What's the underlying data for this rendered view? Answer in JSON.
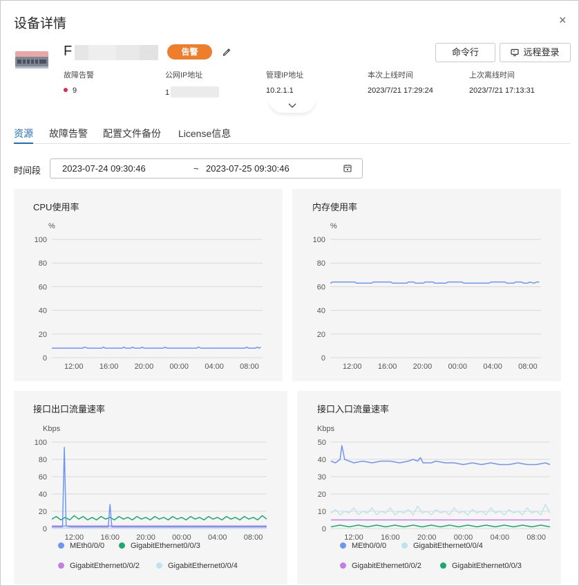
{
  "dialog": {
    "title": "设备详情",
    "close_glyph": "×"
  },
  "device": {
    "name_visible": "F",
    "status_badge": "告警",
    "buttons": {
      "command": "命令行",
      "remote_login": "远程登录"
    },
    "info": [
      {
        "label": "故障告警",
        "value": "9"
      },
      {
        "label": "公网IP地址",
        "value": "1"
      },
      {
        "label": "管理IP地址",
        "value": "10.2.1.1"
      },
      {
        "label": "本次上线时间",
        "value": "2023/7/21 17:29:24"
      },
      {
        "label": "上次离线时间",
        "value": "2023/7/21 17:13:31"
      }
    ]
  },
  "tabs": [
    {
      "label": "资源",
      "active": true
    },
    {
      "label": "故障告警",
      "active": false
    },
    {
      "label": "配置文件备份",
      "active": false
    },
    {
      "label": "License信息",
      "active": false
    }
  ],
  "period": {
    "label": "时间段",
    "start": "2023-07-24 09:30:46",
    "separator": "~",
    "end": "2023-07-25 09:30:46"
  },
  "colors": {
    "accent": "#1f6fba",
    "alarm": "#ee7d2c",
    "line_blue": "#6f95f2"
  },
  "chart_data": [
    {
      "type": "line",
      "title": "CPU使用率",
      "ylabel": "%",
      "ylim": [
        0,
        100
      ],
      "yticks": [
        0,
        20,
        40,
        60,
        80,
        100
      ],
      "xticks": [
        "12:00",
        "16:00",
        "20:00",
        "00:00",
        "04:00",
        "08:00"
      ],
      "xlim": [
        9.5,
        33.5
      ],
      "series": [
        {
          "color": "#6f95f2",
          "points": [
            [
              9.5,
              8
            ],
            [
              13.0,
              8
            ],
            [
              13.2,
              9
            ],
            [
              13.6,
              8
            ],
            [
              15.2,
              8
            ],
            [
              15.4,
              9
            ],
            [
              15.6,
              8
            ],
            [
              17.5,
              8
            ],
            [
              17.7,
              9
            ],
            [
              17.9,
              8
            ],
            [
              18.5,
              8
            ],
            [
              18.7,
              9
            ],
            [
              18.9,
              8
            ],
            [
              19.6,
              8
            ],
            [
              19.8,
              9
            ],
            [
              20.0,
              8
            ],
            [
              22.2,
              8
            ],
            [
              22.4,
              9
            ],
            [
              22.6,
              8
            ],
            [
              26.0,
              8
            ],
            [
              26.2,
              9
            ],
            [
              26.5,
              8
            ],
            [
              31.5,
              8
            ],
            [
              31.7,
              9
            ],
            [
              31.9,
              8
            ],
            [
              32.7,
              8
            ],
            [
              32.9,
              9
            ],
            [
              33.1,
              8
            ],
            [
              33.3,
              9
            ]
          ]
        }
      ]
    },
    {
      "type": "line",
      "title": "内存使用率",
      "ylabel": "%",
      "ylim": [
        0,
        100
      ],
      "yticks": [
        0,
        20,
        40,
        60,
        80,
        100
      ],
      "xticks": [
        "12:00",
        "16:00",
        "20:00",
        "00:00",
        "04:00",
        "08:00"
      ],
      "xlim": [
        9.5,
        33.5
      ],
      "series": [
        {
          "color": "#6f95f2",
          "points": [
            [
              9.5,
              63
            ],
            [
              9.8,
              64
            ],
            [
              12.3,
              64
            ],
            [
              12.5,
              63
            ],
            [
              14.2,
              63
            ],
            [
              14.4,
              64
            ],
            [
              16.4,
              64
            ],
            [
              16.6,
              63
            ],
            [
              18.2,
              63
            ],
            [
              18.4,
              64
            ],
            [
              19.0,
              64
            ],
            [
              19.2,
              63
            ],
            [
              20.1,
              63
            ],
            [
              20.3,
              64
            ],
            [
              21.2,
              64
            ],
            [
              21.4,
              63
            ],
            [
              22.7,
              63
            ],
            [
              22.9,
              64
            ],
            [
              24.5,
              64
            ],
            [
              24.7,
              63
            ],
            [
              27.6,
              63
            ],
            [
              27.8,
              64
            ],
            [
              29.4,
              64
            ],
            [
              29.6,
              63
            ],
            [
              30.4,
              63
            ],
            [
              30.6,
              64
            ],
            [
              31.3,
              64
            ],
            [
              31.5,
              63
            ],
            [
              32.0,
              63
            ],
            [
              32.2,
              64
            ],
            [
              32.7,
              63
            ],
            [
              33.0,
              64
            ],
            [
              33.3,
              64
            ]
          ]
        }
      ]
    },
    {
      "type": "line",
      "title": "接口出口流量速率",
      "ylabel": "Kbps",
      "ylim": [
        0,
        100
      ],
      "yticks": [
        0,
        20,
        40,
        60,
        80,
        100
      ],
      "xticks": [
        "12:00",
        "16:00",
        "20:00",
        "00:00",
        "04:00",
        "08:00"
      ],
      "xlim": [
        9.5,
        33.5
      ],
      "series": [
        {
          "name": "MEth0/0/0",
          "color": "#6f95f2",
          "points": [
            [
              9.5,
              2
            ],
            [
              10.7,
              2
            ],
            [
              10.9,
              94
            ],
            [
              11.1,
              3
            ],
            [
              11.6,
              2
            ],
            [
              15.8,
              2
            ],
            [
              16.0,
              28
            ],
            [
              16.2,
              2
            ],
            [
              33.5,
              2
            ]
          ]
        },
        {
          "name": "GigabitEthernet0/0/3",
          "color": "#1aaa6e",
          "points": [
            [
              9.5,
              11
            ],
            [
              10.0,
              14
            ],
            [
              10.5,
              10
            ],
            [
              11.0,
              13
            ],
            [
              11.5,
              10
            ],
            [
              12.0,
              15
            ],
            [
              12.5,
              11
            ],
            [
              13.0,
              14
            ],
            [
              13.5,
              10
            ],
            [
              14.0,
              13
            ],
            [
              14.5,
              10
            ],
            [
              15.0,
              14
            ],
            [
              15.5,
              11
            ],
            [
              16.0,
              13
            ],
            [
              16.5,
              10
            ],
            [
              17.0,
              14
            ],
            [
              17.5,
              11
            ],
            [
              18.0,
              13
            ],
            [
              18.5,
              10
            ],
            [
              19.0,
              14
            ],
            [
              19.5,
              11
            ],
            [
              20.0,
              13
            ],
            [
              20.5,
              10
            ],
            [
              21.0,
              14
            ],
            [
              21.5,
              11
            ],
            [
              22.0,
              13
            ],
            [
              22.5,
              10
            ],
            [
              23.0,
              14
            ],
            [
              23.5,
              11
            ],
            [
              24.0,
              13
            ],
            [
              24.5,
              10
            ],
            [
              25.0,
              14
            ],
            [
              25.5,
              11
            ],
            [
              26.0,
              13
            ],
            [
              26.5,
              10
            ],
            [
              27.0,
              14
            ],
            [
              27.5,
              11
            ],
            [
              28.0,
              13
            ],
            [
              28.5,
              10
            ],
            [
              29.0,
              14
            ],
            [
              29.5,
              11
            ],
            [
              30.0,
              13
            ],
            [
              30.5,
              10
            ],
            [
              31.0,
              14
            ],
            [
              31.5,
              11
            ],
            [
              32.0,
              13
            ],
            [
              32.5,
              10
            ],
            [
              33.0,
              15
            ],
            [
              33.5,
              11
            ]
          ]
        },
        {
          "name": "GigabitEthernet0/0/2",
          "color": "#c27de8",
          "points": [
            [
              9.5,
              3
            ],
            [
              33.5,
              3
            ]
          ]
        },
        {
          "name": "GigabitEthernet0/0/4",
          "color": "#bfe3ee",
          "points": [
            [
              9.5,
              1
            ],
            [
              33.5,
              1
            ]
          ]
        }
      ]
    },
    {
      "type": "line",
      "title": "接口入口流量速率",
      "ylabel": "Kbps",
      "ylim": [
        0,
        50
      ],
      "yticks": [
        0,
        10,
        20,
        30,
        40,
        50
      ],
      "xticks": [
        "12:00",
        "16:00",
        "20:00",
        "00:00",
        "04:00",
        "08:00"
      ],
      "xlim": [
        9.5,
        33.5
      ],
      "series": [
        {
          "name": "MEth0/0/0",
          "color": "#6f95f2",
          "points": [
            [
              9.5,
              39
            ],
            [
              10.0,
              38
            ],
            [
              10.5,
              40
            ],
            [
              10.7,
              48
            ],
            [
              11.0,
              40
            ],
            [
              11.5,
              39
            ],
            [
              12.0,
              38
            ],
            [
              13.0,
              39
            ],
            [
              14.0,
              38
            ],
            [
              15.0,
              39
            ],
            [
              16.0,
              39
            ],
            [
              17.0,
              38
            ],
            [
              18.0,
              39
            ],
            [
              18.5,
              40
            ],
            [
              19.0,
              39
            ],
            [
              19.3,
              41
            ],
            [
              19.6,
              38
            ],
            [
              20.5,
              38
            ],
            [
              21.0,
              39
            ],
            [
              22.0,
              38
            ],
            [
              23.0,
              38
            ],
            [
              24.0,
              37
            ],
            [
              25.0,
              38
            ],
            [
              26.0,
              37
            ],
            [
              27.0,
              38
            ],
            [
              28.0,
              37
            ],
            [
              29.0,
              37
            ],
            [
              30.0,
              38
            ],
            [
              31.0,
              37
            ],
            [
              32.0,
              37
            ],
            [
              33.0,
              38
            ],
            [
              33.5,
              37
            ]
          ]
        },
        {
          "name": "GigabitEthernet0/0/4",
          "color": "#bfe3ee",
          "points": [
            [
              9.5,
              9
            ],
            [
              10.0,
              11
            ],
            [
              10.5,
              8
            ],
            [
              11.0,
              10
            ],
            [
              11.5,
              9
            ],
            [
              12.0,
              12
            ],
            [
              12.5,
              8
            ],
            [
              13.0,
              10
            ],
            [
              13.5,
              9
            ],
            [
              14.0,
              12
            ],
            [
              14.5,
              8
            ],
            [
              15.0,
              10
            ],
            [
              15.5,
              9
            ],
            [
              16.0,
              12
            ],
            [
              16.5,
              8
            ],
            [
              17.0,
              10
            ],
            [
              17.5,
              9
            ],
            [
              18.0,
              11
            ],
            [
              18.5,
              8
            ],
            [
              19.0,
              13
            ],
            [
              19.5,
              9
            ],
            [
              20.0,
              10
            ],
            [
              20.5,
              8
            ],
            [
              21.0,
              11
            ],
            [
              21.5,
              9
            ],
            [
              22.0,
              10
            ],
            [
              22.5,
              8
            ],
            [
              23.0,
              12
            ],
            [
              23.5,
              9
            ],
            [
              24.0,
              10
            ],
            [
              24.5,
              8
            ],
            [
              25.0,
              11
            ],
            [
              25.5,
              9
            ],
            [
              26.0,
              10
            ],
            [
              26.5,
              8
            ],
            [
              27.0,
              12
            ],
            [
              27.5,
              9
            ],
            [
              28.0,
              10
            ],
            [
              28.5,
              8
            ],
            [
              29.0,
              11
            ],
            [
              29.5,
              9
            ],
            [
              30.0,
              10
            ],
            [
              30.5,
              8
            ],
            [
              31.0,
              12
            ],
            [
              31.5,
              9
            ],
            [
              32.0,
              10
            ],
            [
              32.5,
              8
            ],
            [
              33.0,
              14
            ],
            [
              33.5,
              9
            ]
          ]
        },
        {
          "name": "GigabitEthernet0/0/2",
          "color": "#c27de8",
          "points": [
            [
              9.5,
              5
            ],
            [
              33.5,
              5
            ]
          ]
        },
        {
          "name": "GigabitEthernet0/0/3",
          "color": "#1aaa6e",
          "points": [
            [
              9.5,
              1
            ],
            [
              10.5,
              2
            ],
            [
              11.5,
              1
            ],
            [
              12.5,
              2
            ],
            [
              13.5,
              1
            ],
            [
              14.5,
              2
            ],
            [
              15.5,
              1
            ],
            [
              16.5,
              2
            ],
            [
              17.5,
              1
            ],
            [
              18.5,
              2
            ],
            [
              19.5,
              1
            ],
            [
              20.5,
              2
            ],
            [
              21.5,
              1
            ],
            [
              22.5,
              2
            ],
            [
              23.5,
              1
            ],
            [
              24.5,
              2
            ],
            [
              25.5,
              1
            ],
            [
              26.5,
              2
            ],
            [
              27.5,
              1
            ],
            [
              28.5,
              2
            ],
            [
              29.5,
              1
            ],
            [
              30.5,
              2
            ],
            [
              31.5,
              1
            ],
            [
              32.5,
              2
            ],
            [
              33.5,
              1
            ]
          ]
        }
      ]
    }
  ]
}
